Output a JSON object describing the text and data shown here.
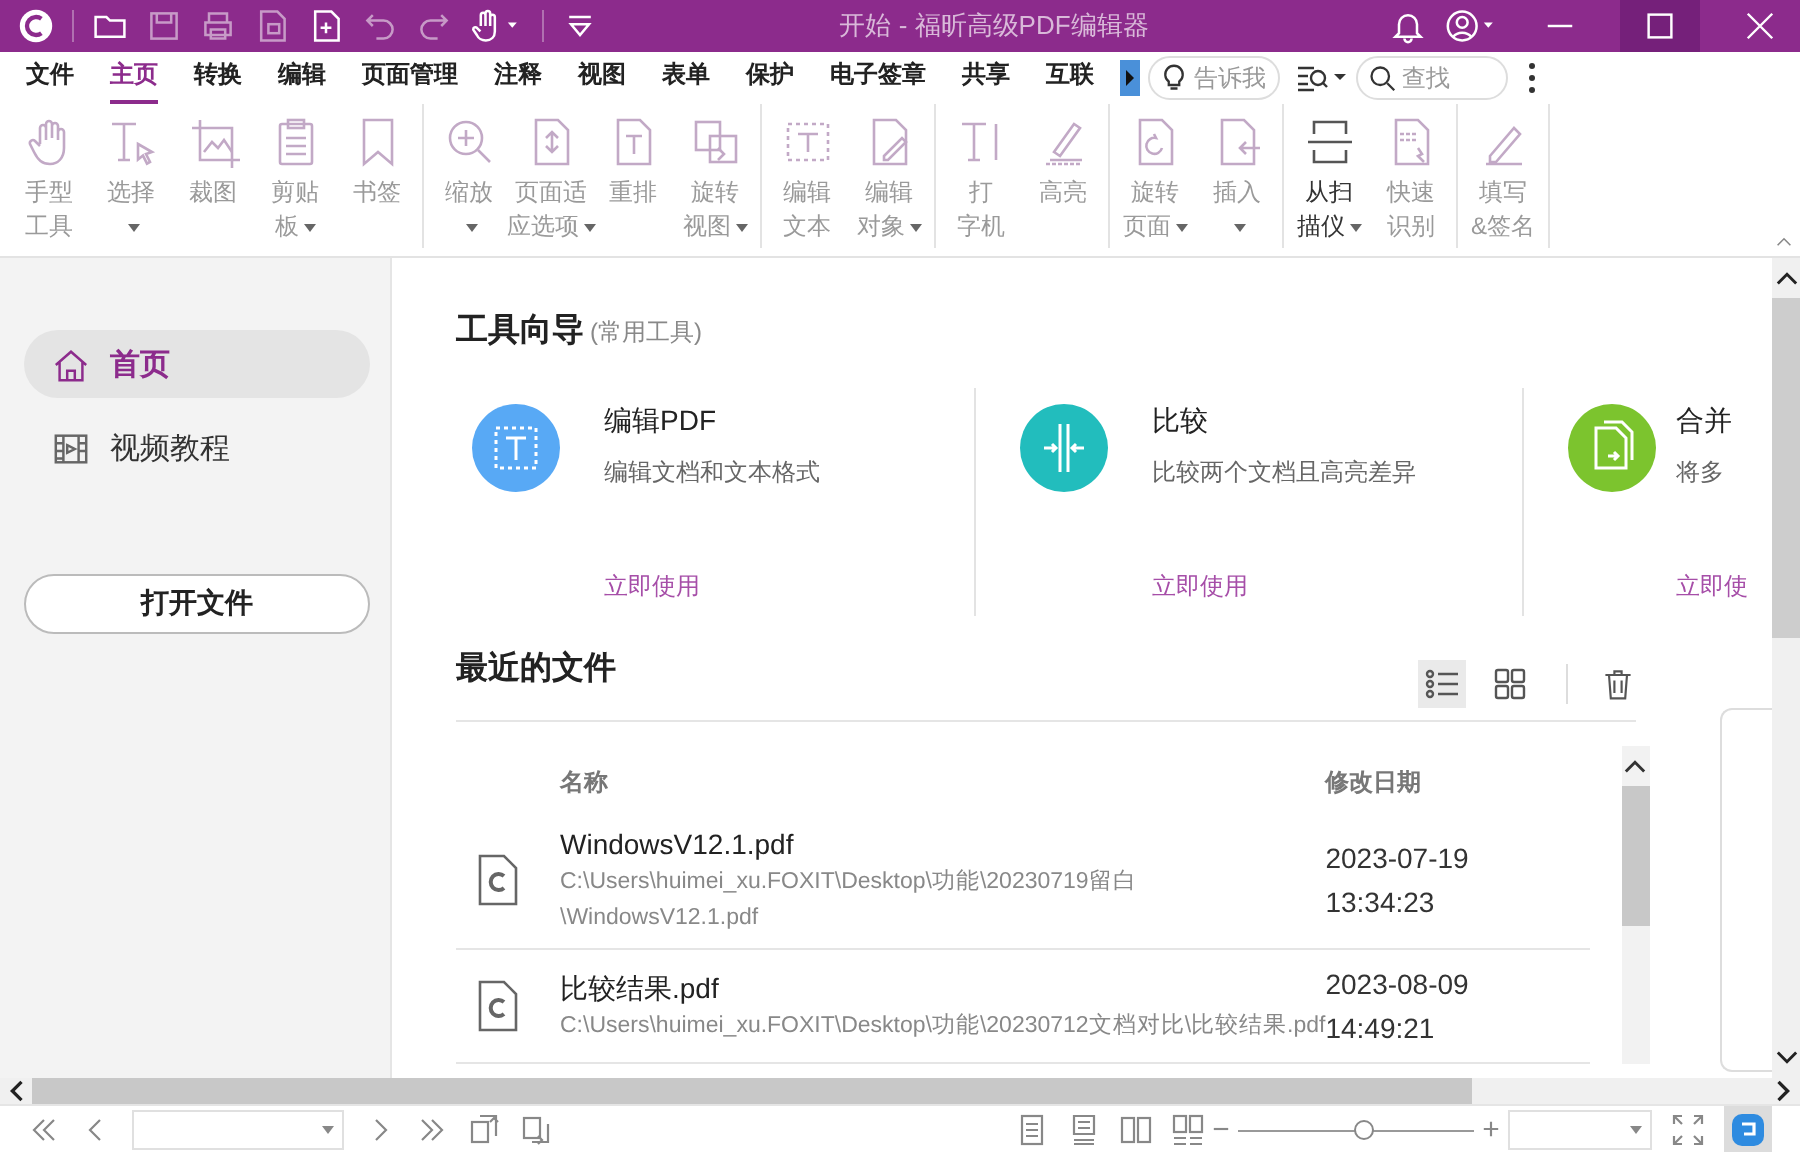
{
  "window": {
    "title": "开始 - 福昕高级PDF编辑器"
  },
  "menu_tabs": [
    {
      "label": "文件",
      "selected": false
    },
    {
      "label": "主页",
      "selected": true
    },
    {
      "label": "转换",
      "selected": false
    },
    {
      "label": "编辑",
      "selected": false
    },
    {
      "label": "页面管理",
      "selected": false
    },
    {
      "label": "注释",
      "selected": false
    },
    {
      "label": "视图",
      "selected": false
    },
    {
      "label": "表单",
      "selected": false
    },
    {
      "label": "保护",
      "selected": false
    },
    {
      "label": "电子签章",
      "selected": false
    },
    {
      "label": "共享",
      "selected": false
    },
    {
      "label": "互联",
      "selected": false
    }
  ],
  "tell_me": {
    "placeholder": "告诉我"
  },
  "find": {
    "placeholder": "查找"
  },
  "ribbon_groups": [
    {
      "tools": [
        {
          "label_lines": [
            "手型",
            "工具"
          ],
          "disabled": true,
          "has_menu": false
        },
        {
          "label_lines": [
            "选择"
          ],
          "disabled": true,
          "has_menu": true
        },
        {
          "label_lines": [
            "裁图"
          ],
          "disabled": true,
          "has_menu": false
        },
        {
          "label_lines": [
            "剪贴",
            "板"
          ],
          "disabled": true,
          "has_menu": true
        },
        {
          "label_lines": [
            "书签"
          ],
          "disabled": true,
          "has_menu": false
        }
      ]
    },
    {
      "tools": [
        {
          "label_lines": [
            "缩放"
          ],
          "disabled": true,
          "has_menu": true
        },
        {
          "label_lines": [
            "页面适",
            "应选项"
          ],
          "disabled": true,
          "has_menu": true
        },
        {
          "label_lines": [
            "重排"
          ],
          "disabled": true,
          "has_menu": false
        },
        {
          "label_lines": [
            "旋转",
            "视图"
          ],
          "disabled": true,
          "has_menu": true
        }
      ]
    },
    {
      "tools": [
        {
          "label_lines": [
            "编辑",
            "文本"
          ],
          "disabled": true,
          "has_menu": false
        },
        {
          "label_lines": [
            "编辑",
            "对象"
          ],
          "disabled": true,
          "has_menu": true
        }
      ]
    },
    {
      "tools": [
        {
          "label_lines": [
            "打",
            "字机"
          ],
          "disabled": true,
          "has_menu": false
        },
        {
          "label_lines": [
            "高亮"
          ],
          "disabled": true,
          "has_menu": false
        }
      ]
    },
    {
      "tools": [
        {
          "label_lines": [
            "旋转",
            "页面"
          ],
          "disabled": true,
          "has_menu": true
        },
        {
          "label_lines": [
            "插入"
          ],
          "disabled": true,
          "has_menu": true
        }
      ]
    },
    {
      "tools": [
        {
          "label_lines": [
            "从扫",
            "描仪"
          ],
          "disabled": false,
          "has_menu": true
        },
        {
          "label_lines": [
            "快速",
            "识别"
          ],
          "disabled": true,
          "has_menu": false
        }
      ]
    },
    {
      "tools": [
        {
          "label_lines": [
            "填写",
            "&签名"
          ],
          "disabled": true,
          "has_menu": false
        }
      ]
    }
  ],
  "sidebar": {
    "items": [
      {
        "label": "首页",
        "selected": true
      },
      {
        "label": "视频教程",
        "selected": false
      }
    ],
    "open_button": "打开文件"
  },
  "tool_guide": {
    "title": "工具向导",
    "subtitle": "(常用工具)",
    "cards": [
      {
        "title": "编辑PDF",
        "description": "编辑文档和文本格式",
        "action": "立即使用",
        "color": "#58a9f5"
      },
      {
        "title": "比较",
        "description": "比较两个文档且高亮差异",
        "action": "立即使用",
        "color": "#22bdbd"
      },
      {
        "title": "合并",
        "description": "将多",
        "action": "立即使",
        "color": "#7cc42e"
      }
    ]
  },
  "recent_files": {
    "title": "最近的文件",
    "view_modes": [
      {
        "kind": "list",
        "selected": true
      },
      {
        "kind": "grid",
        "selected": false
      }
    ],
    "columns": [
      "名称",
      "修改日期"
    ],
    "rows": [
      {
        "name": "WindowsV12.1.pdf",
        "path_lines": [
          "C:\\Users\\huimei_xu.FOXIT\\Desktop\\功能\\20230719留白",
          "\\WindowsV12.1.pdf"
        ],
        "modified_lines": [
          "2023-07-19",
          "13:34:23"
        ]
      },
      {
        "name": "比较结果.pdf",
        "path_lines": [
          "C:\\Users\\huimei_xu.FOXIT\\Desktop\\功能\\20230712文档对比\\比较结果.pdf"
        ],
        "modified_lines": [
          "2023-08-09",
          "14:49:21"
        ]
      }
    ]
  },
  "status_bar": {
    "zoom": {
      "level": 0.53
    }
  }
}
